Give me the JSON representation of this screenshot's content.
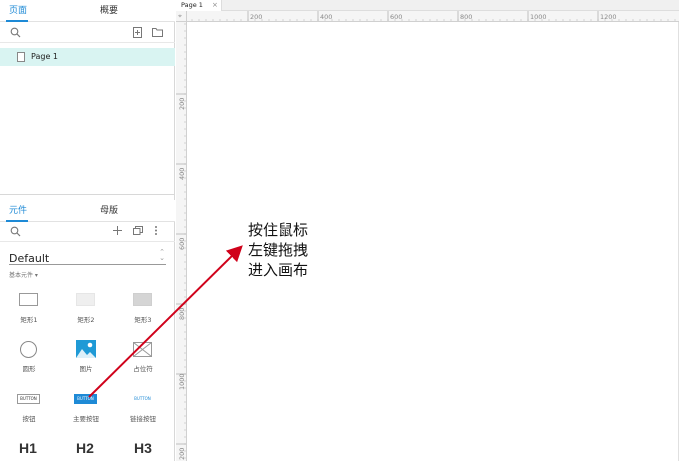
{
  "left_panel": {
    "top_tabs": {
      "pages": "页面",
      "outline": "概要"
    },
    "pages": [
      {
        "label": "Page 1"
      }
    ],
    "bottom_tabs": {
      "widgets": "元件",
      "masters": "母版"
    },
    "library": {
      "selected": "Default",
      "category": "基本元件 ▾"
    },
    "widgets": [
      {
        "label": "矩形1"
      },
      {
        "label": "矩形2"
      },
      {
        "label": "矩形3"
      },
      {
        "label": "圆形"
      },
      {
        "label": "图片"
      },
      {
        "label": "占位符"
      },
      {
        "label": "按钮",
        "button_text": "BUTTON"
      },
      {
        "label": "主要按钮",
        "button_text": "BUTTON"
      },
      {
        "label": "链接按钮",
        "button_text": "BUTTON"
      }
    ],
    "headings": [
      "H1",
      "H2",
      "H3"
    ]
  },
  "editor": {
    "doc_tab": {
      "label": "Page 1",
      "close": "×"
    },
    "ruler_top": [
      "0",
      "200",
      "400",
      "600",
      "800",
      "1000",
      "1200"
    ],
    "ruler_left": [
      "200",
      "400",
      "600",
      "800",
      "1000",
      "200"
    ],
    "annotation": [
      "按住鼠标",
      "左键拖拽",
      "进入画布"
    ]
  },
  "colors": {
    "accent": "#1e8ad6",
    "selected_row": "#d9f4f2",
    "arrow": "#d0021b"
  }
}
